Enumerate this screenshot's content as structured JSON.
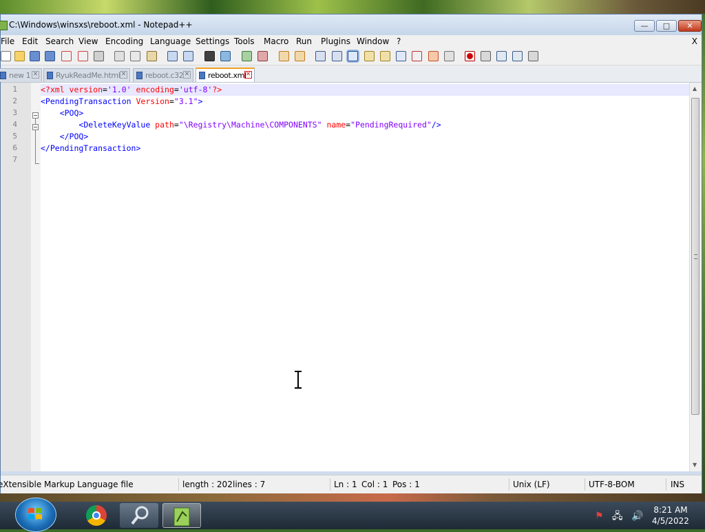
{
  "window": {
    "title": "C:\\Windows\\winsxs\\reboot.xml - Notepad++",
    "min_glyph": "—",
    "max_glyph": "□",
    "close_glyph": "✕"
  },
  "menu": {
    "items": [
      "File",
      "Edit",
      "Search",
      "View",
      "Encoding",
      "Language",
      "Settings",
      "Tools",
      "Macro",
      "Run",
      "Plugins",
      "Window",
      "?"
    ],
    "close_doc": "X"
  },
  "tabs": [
    {
      "label": "new 1",
      "active": false
    },
    {
      "label": "RyukReadMe.html",
      "active": false
    },
    {
      "label": "reboot.c32",
      "active": false
    },
    {
      "label": "reboot.xml",
      "active": true
    }
  ],
  "tab_close_glyph": "✕",
  "editor": {
    "line_numbers": [
      "1",
      "2",
      "3",
      "4",
      "5",
      "6",
      "7"
    ],
    "lines": [
      {
        "indent": "",
        "parts": [
          [
            "c-decl",
            "<?xml "
          ],
          [
            "c-attr",
            "version"
          ],
          [
            "c-txt",
            "="
          ],
          [
            "c-str",
            "'1.0'"
          ],
          [
            "c-txt",
            " "
          ],
          [
            "c-attr",
            "encoding"
          ],
          [
            "c-txt",
            "="
          ],
          [
            "c-str",
            "'utf-8'"
          ],
          [
            "c-decl",
            "?>"
          ]
        ]
      },
      {
        "indent": "",
        "parts": [
          [
            "c-tag",
            "<PendingTransaction "
          ],
          [
            "c-attr",
            "Version"
          ],
          [
            "c-txt",
            "="
          ],
          [
            "c-str",
            "\"3.1\""
          ],
          [
            "c-tag",
            ">"
          ]
        ]
      },
      {
        "indent": "    ",
        "parts": [
          [
            "c-tag",
            "<POQ>"
          ]
        ]
      },
      {
        "indent": "        ",
        "parts": [
          [
            "c-tag",
            "<DeleteKeyValue "
          ],
          [
            "c-attr",
            "path"
          ],
          [
            "c-txt",
            "="
          ],
          [
            "c-str",
            "\"\\Registry\\Machine\\COMPONENTS\""
          ],
          [
            "c-txt",
            " "
          ],
          [
            "c-attr",
            "name"
          ],
          [
            "c-txt",
            "="
          ],
          [
            "c-str",
            "\"PendingRequired\""
          ],
          [
            "c-tag",
            "/>"
          ]
        ]
      },
      {
        "indent": "    ",
        "parts": [
          [
            "c-tag",
            "</POQ>"
          ]
        ]
      },
      {
        "indent": "",
        "parts": [
          [
            "c-tag",
            "</PendingTransaction>"
          ]
        ]
      },
      {
        "indent": "",
        "parts": []
      }
    ]
  },
  "status": {
    "file_type": "eXtensible Markup Language file",
    "length": "length : 202",
    "lines": "lines : 7",
    "ln": "Ln : 1",
    "col": "Col : 1",
    "pos": "Pos : 1",
    "eol": "Unix (LF)",
    "encoding": "UTF-8-BOM",
    "mode": "INS"
  },
  "taskbar": {
    "time": "8:21 AM",
    "date": "4/5/2022"
  },
  "colors": {
    "tag": "#0000ff",
    "attr": "#ff0000",
    "string": "#8000ff",
    "active_tab_accent": "#f5a020"
  }
}
